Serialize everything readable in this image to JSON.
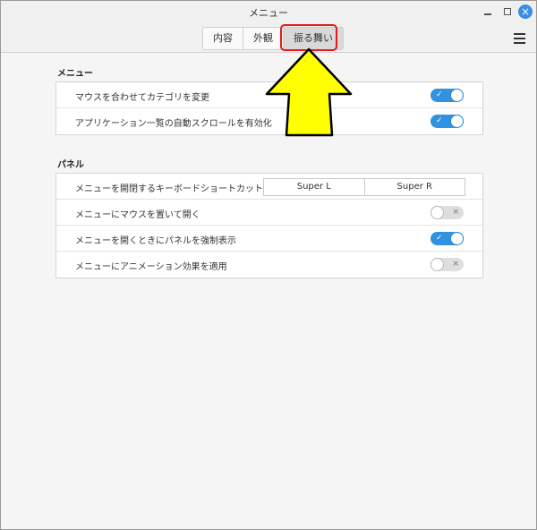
{
  "window": {
    "title": "メニュー",
    "controls": {
      "minimize": "minimize-icon",
      "maximize": "maximize-icon",
      "close": "close-icon"
    }
  },
  "tabs": [
    {
      "label": "内容",
      "active": false
    },
    {
      "label": "外観",
      "active": false
    },
    {
      "label": "振る舞い",
      "active": true
    }
  ],
  "menu_button_icon": "hamburger-menu-icon",
  "annotation": {
    "highlight_color": "#e31b1b",
    "arrow_color": "#ffff00"
  },
  "sections": {
    "menu": {
      "title": "メニュー",
      "rows": [
        {
          "label": "マウスを合わせてカテゴリを変更",
          "enabled": true
        },
        {
          "label": "アプリケーション一覧の自動スクロールを有効化",
          "enabled": true
        }
      ]
    },
    "panel": {
      "title": "パネル",
      "shortcut": {
        "label": "メニューを開閉するキーボードショートカット",
        "keys": [
          "Super L",
          "Super R"
        ]
      },
      "rows": [
        {
          "label": "メニューにマウスを置いて開く",
          "enabled": false
        },
        {
          "label": "メニューを開くときにパネルを強制表示",
          "enabled": true
        },
        {
          "label": "メニューにアニメーション効果を適用",
          "enabled": false
        }
      ]
    }
  },
  "colors": {
    "accent": "#3092e0",
    "switch_off": "#dedede",
    "background": "#f5f5f5"
  }
}
